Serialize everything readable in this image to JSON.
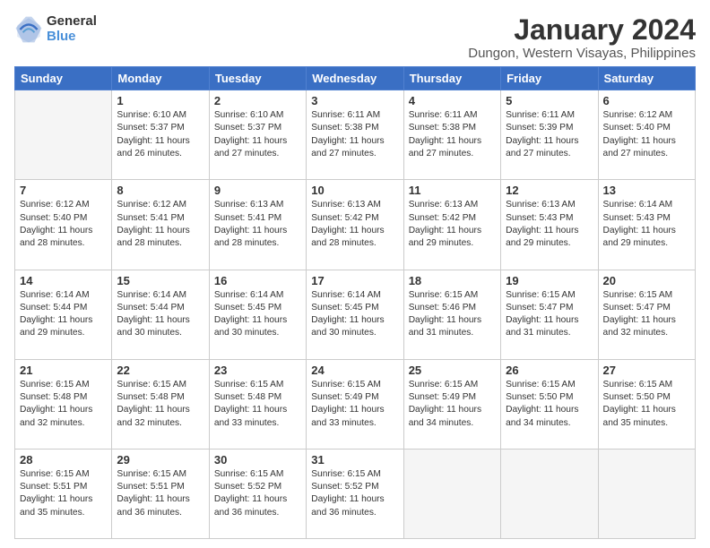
{
  "logo": {
    "general": "General",
    "blue": "Blue"
  },
  "title": "January 2024",
  "subtitle": "Dungon, Western Visayas, Philippines",
  "days_header": [
    "Sunday",
    "Monday",
    "Tuesday",
    "Wednesday",
    "Thursday",
    "Friday",
    "Saturday"
  ],
  "weeks": [
    [
      {
        "day": "",
        "info": ""
      },
      {
        "day": "1",
        "info": "Sunrise: 6:10 AM\nSunset: 5:37 PM\nDaylight: 11 hours\nand 26 minutes."
      },
      {
        "day": "2",
        "info": "Sunrise: 6:10 AM\nSunset: 5:37 PM\nDaylight: 11 hours\nand 27 minutes."
      },
      {
        "day": "3",
        "info": "Sunrise: 6:11 AM\nSunset: 5:38 PM\nDaylight: 11 hours\nand 27 minutes."
      },
      {
        "day": "4",
        "info": "Sunrise: 6:11 AM\nSunset: 5:38 PM\nDaylight: 11 hours\nand 27 minutes."
      },
      {
        "day": "5",
        "info": "Sunrise: 6:11 AM\nSunset: 5:39 PM\nDaylight: 11 hours\nand 27 minutes."
      },
      {
        "day": "6",
        "info": "Sunrise: 6:12 AM\nSunset: 5:40 PM\nDaylight: 11 hours\nand 27 minutes."
      }
    ],
    [
      {
        "day": "7",
        "info": "Sunrise: 6:12 AM\nSunset: 5:40 PM\nDaylight: 11 hours\nand 28 minutes."
      },
      {
        "day": "8",
        "info": "Sunrise: 6:12 AM\nSunset: 5:41 PM\nDaylight: 11 hours\nand 28 minutes."
      },
      {
        "day": "9",
        "info": "Sunrise: 6:13 AM\nSunset: 5:41 PM\nDaylight: 11 hours\nand 28 minutes."
      },
      {
        "day": "10",
        "info": "Sunrise: 6:13 AM\nSunset: 5:42 PM\nDaylight: 11 hours\nand 28 minutes."
      },
      {
        "day": "11",
        "info": "Sunrise: 6:13 AM\nSunset: 5:42 PM\nDaylight: 11 hours\nand 29 minutes."
      },
      {
        "day": "12",
        "info": "Sunrise: 6:13 AM\nSunset: 5:43 PM\nDaylight: 11 hours\nand 29 minutes."
      },
      {
        "day": "13",
        "info": "Sunrise: 6:14 AM\nSunset: 5:43 PM\nDaylight: 11 hours\nand 29 minutes."
      }
    ],
    [
      {
        "day": "14",
        "info": "Sunrise: 6:14 AM\nSunset: 5:44 PM\nDaylight: 11 hours\nand 29 minutes."
      },
      {
        "day": "15",
        "info": "Sunrise: 6:14 AM\nSunset: 5:44 PM\nDaylight: 11 hours\nand 30 minutes."
      },
      {
        "day": "16",
        "info": "Sunrise: 6:14 AM\nSunset: 5:45 PM\nDaylight: 11 hours\nand 30 minutes."
      },
      {
        "day": "17",
        "info": "Sunrise: 6:14 AM\nSunset: 5:45 PM\nDaylight: 11 hours\nand 30 minutes."
      },
      {
        "day": "18",
        "info": "Sunrise: 6:15 AM\nSunset: 5:46 PM\nDaylight: 11 hours\nand 31 minutes."
      },
      {
        "day": "19",
        "info": "Sunrise: 6:15 AM\nSunset: 5:47 PM\nDaylight: 11 hours\nand 31 minutes."
      },
      {
        "day": "20",
        "info": "Sunrise: 6:15 AM\nSunset: 5:47 PM\nDaylight: 11 hours\nand 32 minutes."
      }
    ],
    [
      {
        "day": "21",
        "info": "Sunrise: 6:15 AM\nSunset: 5:48 PM\nDaylight: 11 hours\nand 32 minutes."
      },
      {
        "day": "22",
        "info": "Sunrise: 6:15 AM\nSunset: 5:48 PM\nDaylight: 11 hours\nand 32 minutes."
      },
      {
        "day": "23",
        "info": "Sunrise: 6:15 AM\nSunset: 5:48 PM\nDaylight: 11 hours\nand 33 minutes."
      },
      {
        "day": "24",
        "info": "Sunrise: 6:15 AM\nSunset: 5:49 PM\nDaylight: 11 hours\nand 33 minutes."
      },
      {
        "day": "25",
        "info": "Sunrise: 6:15 AM\nSunset: 5:49 PM\nDaylight: 11 hours\nand 34 minutes."
      },
      {
        "day": "26",
        "info": "Sunrise: 6:15 AM\nSunset: 5:50 PM\nDaylight: 11 hours\nand 34 minutes."
      },
      {
        "day": "27",
        "info": "Sunrise: 6:15 AM\nSunset: 5:50 PM\nDaylight: 11 hours\nand 35 minutes."
      }
    ],
    [
      {
        "day": "28",
        "info": "Sunrise: 6:15 AM\nSunset: 5:51 PM\nDaylight: 11 hours\nand 35 minutes."
      },
      {
        "day": "29",
        "info": "Sunrise: 6:15 AM\nSunset: 5:51 PM\nDaylight: 11 hours\nand 36 minutes."
      },
      {
        "day": "30",
        "info": "Sunrise: 6:15 AM\nSunset: 5:52 PM\nDaylight: 11 hours\nand 36 minutes."
      },
      {
        "day": "31",
        "info": "Sunrise: 6:15 AM\nSunset: 5:52 PM\nDaylight: 11 hours\nand 36 minutes."
      },
      {
        "day": "",
        "info": ""
      },
      {
        "day": "",
        "info": ""
      },
      {
        "day": "",
        "info": ""
      }
    ]
  ]
}
